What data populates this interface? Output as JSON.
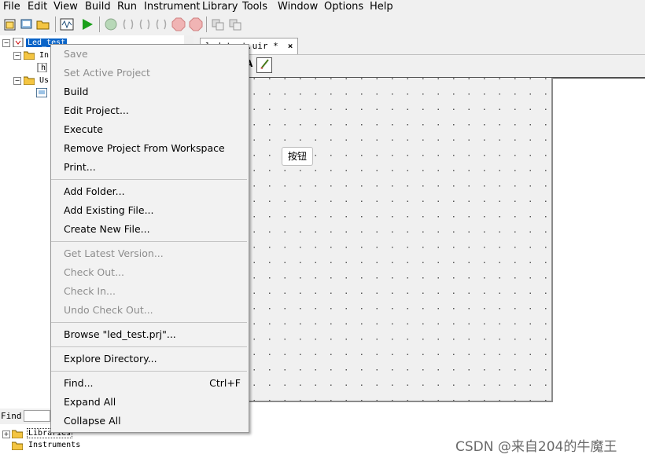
{
  "menubar": [
    "File",
    "Edit",
    "View",
    "Build",
    "Run",
    "Instrument",
    "Library",
    "Tools",
    "Window",
    "Options",
    "Help"
  ],
  "toolbar": {
    "icons": [
      "new-project-icon",
      "open-workspace-icon",
      "open-folder-icon",
      "waveform-icon",
      "run-icon",
      "go-icon",
      "step-into-icon",
      "step-over-icon",
      "step-out-icon",
      "stop-icon",
      "stop-all-icon",
      "breakpoint-icon",
      "copy-panel-icon",
      "paste-panel-icon"
    ]
  },
  "tree": {
    "root": "Led_test",
    "node_instruments": "In",
    "node_h": "h",
    "node_user": "Us"
  },
  "find": {
    "label": "Find",
    "value": ""
  },
  "lower_tree": {
    "libraries": "Libraries",
    "instruments": "Instruments"
  },
  "tab": {
    "title": "led_test.uir *",
    "close": "×"
  },
  "panel": {
    "button_label": "按钮"
  },
  "context_menu": {
    "items": [
      {
        "label": "Save",
        "disabled": true
      },
      {
        "label": "Set Active Project",
        "disabled": true
      },
      {
        "label": "Build",
        "disabled": false
      },
      {
        "label": "Edit Project...",
        "disabled": false
      },
      {
        "label": "Execute",
        "disabled": false
      },
      {
        "label": "Remove Project From Workspace",
        "disabled": false
      },
      {
        "label": "Print...",
        "disabled": false
      },
      {
        "label": "Add Folder...",
        "disabled": false
      },
      {
        "label": "Add Existing File...",
        "disabled": false
      },
      {
        "label": "Create New File...",
        "disabled": false
      },
      {
        "label": "Get Latest Version...",
        "disabled": true
      },
      {
        "label": "Check Out...",
        "disabled": true
      },
      {
        "label": "Check In...",
        "disabled": true
      },
      {
        "label": "Undo Check Out...",
        "disabled": true
      },
      {
        "label": "Browse \"led_test.prj\"...",
        "disabled": false
      },
      {
        "label": "Explore Directory...",
        "disabled": false
      },
      {
        "label": "Find...",
        "disabled": false,
        "shortcut": "Ctrl+F"
      },
      {
        "label": "Expand All",
        "disabled": false
      },
      {
        "label": "Collapse All",
        "disabled": false
      }
    ]
  },
  "watermark": "CSDN @来自204的牛魔王"
}
